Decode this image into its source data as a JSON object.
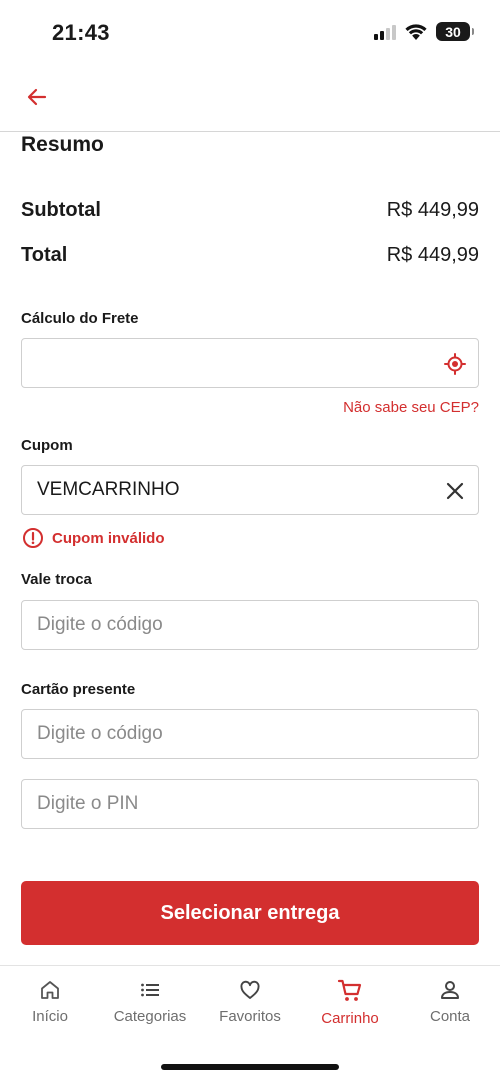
{
  "status_bar": {
    "time": "21:43",
    "battery": "30"
  },
  "summary": {
    "title": "Resumo",
    "subtotal_label": "Subtotal",
    "subtotal_value": "R$ 449,99",
    "total_label": "Total",
    "total_value": "R$ 449,99"
  },
  "shipping": {
    "label": "Cálculo do Frete",
    "value": "",
    "cep_link": "Não sabe seu CEP?"
  },
  "coupon": {
    "label": "Cupom",
    "value": "VEMCARRINHO",
    "error": "Cupom inválido"
  },
  "exchange": {
    "label": "Vale troca",
    "placeholder": "Digite o código"
  },
  "gift_card": {
    "label": "Cartão presente",
    "code_placeholder": "Digite o código",
    "pin_placeholder": "Digite o PIN"
  },
  "cta": {
    "label": "Selecionar entrega"
  },
  "bottom_nav": {
    "items": [
      {
        "label": "Início",
        "icon": "home-icon"
      },
      {
        "label": "Categorias",
        "icon": "list-icon"
      },
      {
        "label": "Favoritos",
        "icon": "heart-icon"
      },
      {
        "label": "Carrinho",
        "icon": "cart-icon",
        "active": true
      },
      {
        "label": "Conta",
        "icon": "user-icon"
      }
    ]
  },
  "colors": {
    "accent": "#d32f2f",
    "border": "#cfcfcf",
    "muted": "#6e6e6e"
  }
}
